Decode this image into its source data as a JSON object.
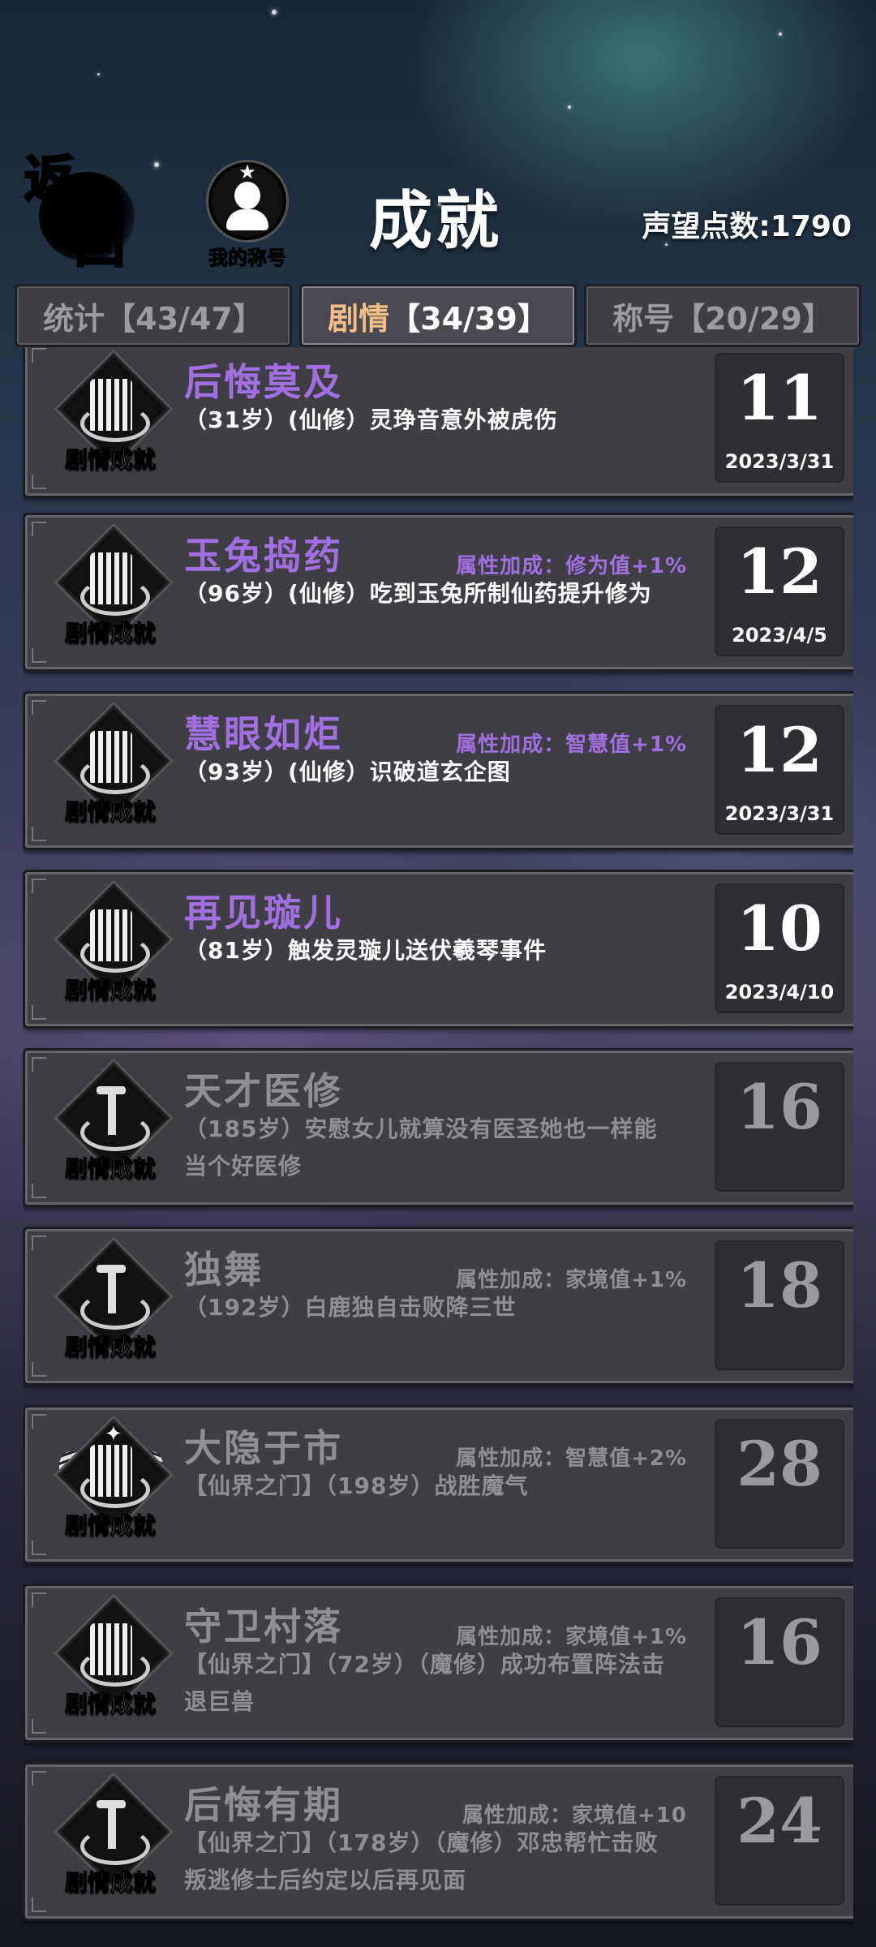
{
  "header": {
    "back_top": "返",
    "back_bottom": "回",
    "my_title_star": "★",
    "my_title_label": "我的称号",
    "title": "成就",
    "fame": "声望点数:1790"
  },
  "tabs": [
    {
      "label": "统计",
      "count": "【43/47】"
    },
    {
      "label": "剧情",
      "count": "【34/39】"
    },
    {
      "label": "称号",
      "count": "【20/29】"
    }
  ],
  "emblem_label": "剧情成就",
  "achievements": [
    {
      "title": "后悔莫及",
      "bonus": "",
      "desc": "（31岁）(仙修）灵琤音意外被虎伤",
      "score": "11",
      "date": "2023/3/31",
      "completed": true,
      "icon": "bars-swirl-icon"
    },
    {
      "title": "玉兔捣药",
      "bonus": "属性加成：修为值+1%",
      "desc": "（96岁）(仙修）吃到玉兔所制仙药提升修为",
      "score": "12",
      "date": "2023/4/5",
      "completed": true,
      "icon": "bars-swirl-icon"
    },
    {
      "title": "慧眼如炬",
      "bonus": "属性加成：智慧值+1%",
      "desc": "（93岁）(仙修）识破道玄企图",
      "score": "12",
      "date": "2023/3/31",
      "completed": true,
      "icon": "bars-swirl-icon"
    },
    {
      "title": "再见璇儿",
      "bonus": "",
      "desc": "（81岁）触发灵璇儿送伏羲琴事件",
      "score": "10",
      "date": "2023/4/10",
      "completed": true,
      "icon": "bars-swirl-icon"
    },
    {
      "title": "天才医修",
      "bonus": "",
      "desc": "（185岁）安慰女儿就算没有医圣她也一样能当个好医修",
      "score": "16",
      "date": "",
      "completed": false,
      "icon": "sword-swirl-icon"
    },
    {
      "title": "独舞",
      "bonus": "属性加成：家境值+1%",
      "desc": "（192岁）白鹿独自击败降三世",
      "score": "18",
      "date": "",
      "completed": false,
      "icon": "sword-swirl-icon"
    },
    {
      "title": "大隐于市",
      "bonus": "属性加成：智慧值+2%",
      "desc": "【仙界之门】（198岁）战胜魔气",
      "score": "28",
      "date": "",
      "completed": false,
      "icon": "winged-emblem-icon"
    },
    {
      "title": "守卫村落",
      "bonus": "属性加成：家境值+1%",
      "desc": "【仙界之门】（72岁）（魔修）成功布置阵法击退巨兽",
      "score": "16",
      "date": "",
      "completed": false,
      "icon": "bars-swirl-icon"
    },
    {
      "title": "后悔有期",
      "bonus": "属性加成：家境值+10",
      "desc": "【仙界之门】（178岁）（魔修）邓忠帮忙击败叛逃修士后约定以后再见面",
      "score": "24",
      "date": "",
      "completed": false,
      "icon": "sword-swirl-icon"
    }
  ]
}
